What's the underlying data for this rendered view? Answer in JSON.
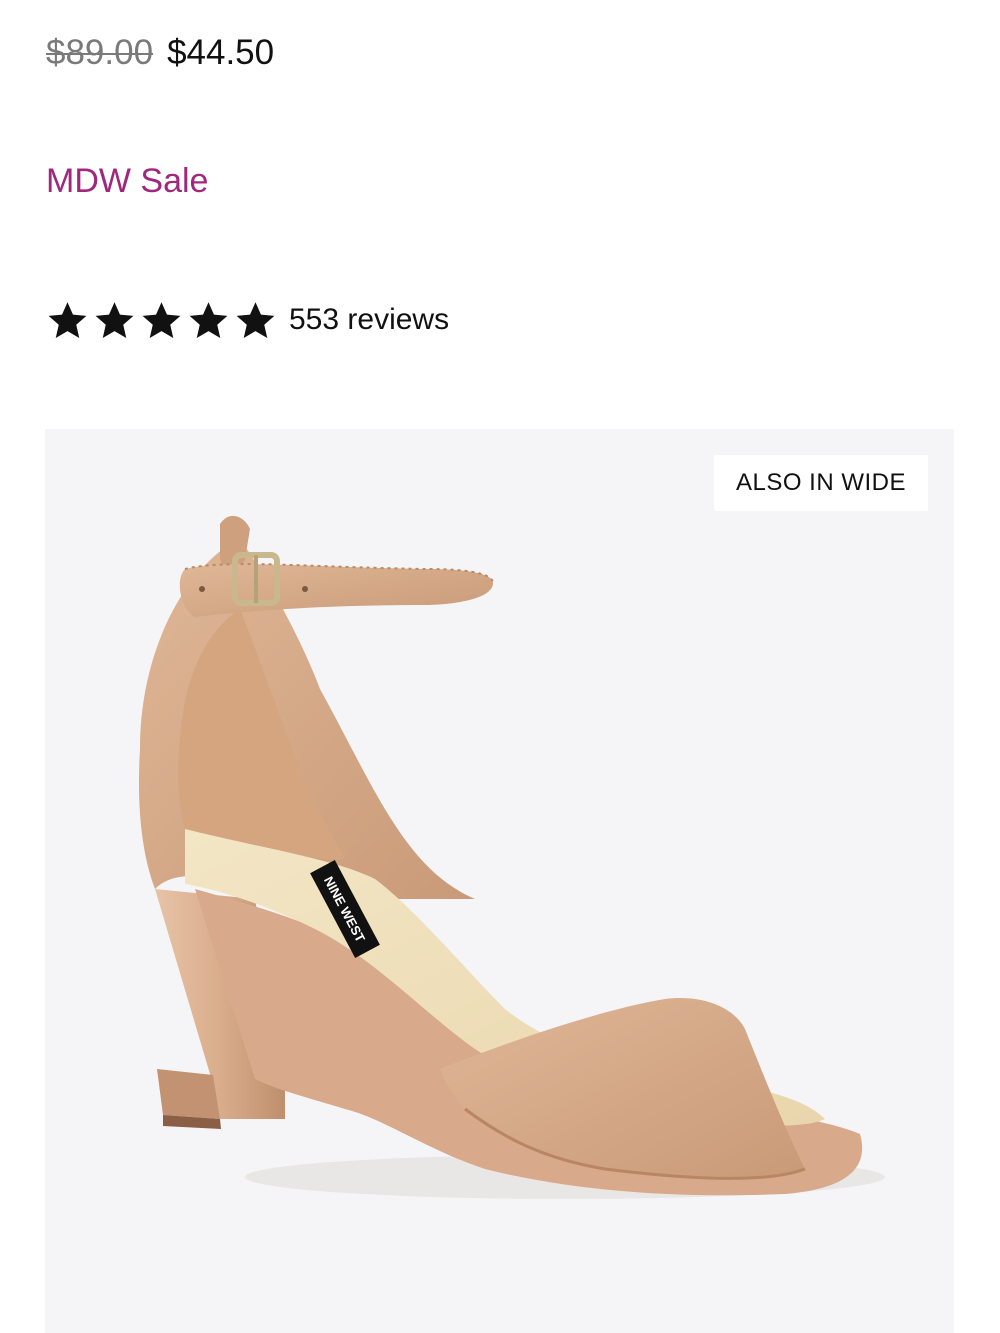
{
  "product": {
    "price_original": "$89.00",
    "price_sale": "$44.50",
    "promo_label": "MDW Sale",
    "rating": 5,
    "rating_max": 5,
    "reviews_label": "553 reviews",
    "badge_label": "ALSO IN WIDE",
    "brand_label_on_shoe": "NINE WEST"
  },
  "colors": {
    "promo": "#a0277c",
    "star": "#111111",
    "media_background": "#f5f5f7",
    "shoe": "#d6aa8a"
  },
  "icons": {
    "star": "star-icon"
  }
}
